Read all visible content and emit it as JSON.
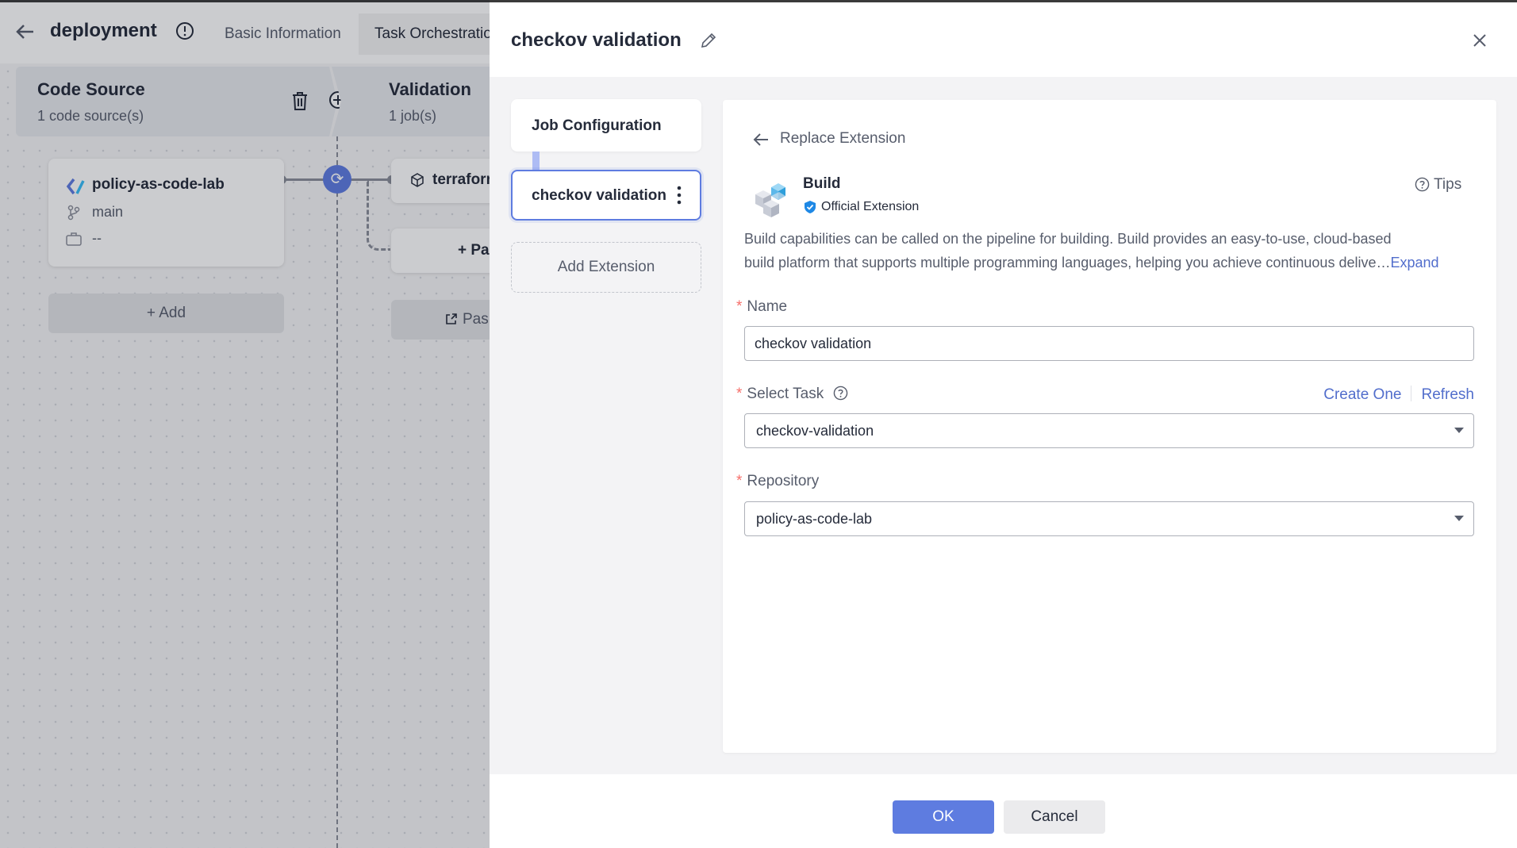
{
  "page": {
    "title": "deployment",
    "tabs": [
      "Basic Information",
      "Task Orchestratio"
    ]
  },
  "pipeline": {
    "stages": [
      {
        "title": "Code Source",
        "subtitle": "1 code source(s)"
      },
      {
        "title": "Validation",
        "subtitle": "1 job(s)"
      }
    ],
    "source": {
      "name": "policy-as-code-lab",
      "branch": "main",
      "extra": "--"
    },
    "add_label": "+ Add",
    "job_label": "terraforr",
    "parallel_label": "+ Pa",
    "paste_label": "Pas"
  },
  "drawer": {
    "title": "checkov validation",
    "steps": {
      "job_configuration": "Job Configuration",
      "current": "checkov validation",
      "add_extension": "Add Extension"
    },
    "panel": {
      "replace_label": "Replace Extension",
      "extension_name": "Build",
      "extension_badge": "Official Extension",
      "tips_label": "Tips",
      "description_line1": "Build capabilities can be called on the pipeline for building. Build provides an easy-to-use, cloud-based",
      "description_line2": "build platform that supports multiple programming languages, helping you achieve continuous delive…",
      "expand_label": "Expand",
      "name_label": "Name",
      "name_value": "checkov validation",
      "select_task_label": "Select Task",
      "create_one": "Create One",
      "refresh": "Refresh",
      "task_value": "checkov-validation",
      "repository_label": "Repository",
      "repository_value": "policy-as-code-lab",
      "required_mark": "*"
    },
    "footer": {
      "ok": "OK",
      "cancel": "Cancel"
    }
  },
  "colors": {
    "accent": "#5e7ce0",
    "link": "#526ecc",
    "required": "#f66f6a"
  }
}
